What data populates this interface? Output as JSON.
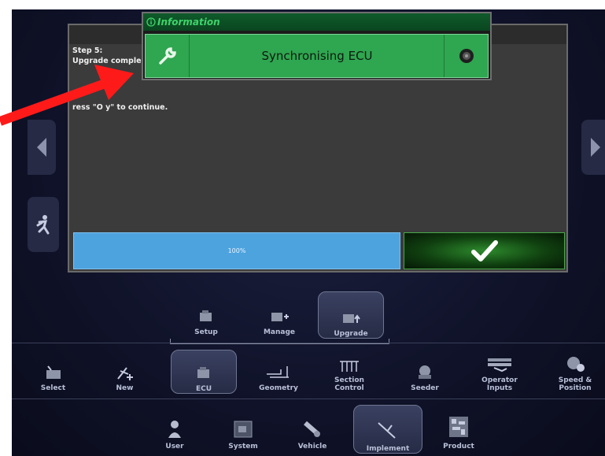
{
  "dialog": {
    "step_title": "Step 5:",
    "step_subtitle": "Upgrade comple",
    "instruction": "ress \"O  y\" to continue.",
    "progress": 1.0,
    "progress_label": "100%",
    "ok_icon": "checkmark-icon"
  },
  "info_popup": {
    "header": "Information",
    "header_icon": "info-icon",
    "message": "Synchronising ECU",
    "left_icon": "wrench-icon",
    "right_icon": "speaker-icon"
  },
  "sub_menu": [
    {
      "label": "Setup",
      "icon": "ecu-setup-icon"
    },
    {
      "label": "Manage",
      "icon": "ecu-manage-icon"
    },
    {
      "label": "Upgrade",
      "icon": "ecu-upgrade-icon",
      "selected": true
    }
  ],
  "implement_menu": [
    {
      "label": "Select",
      "icon": "select-icon"
    },
    {
      "label": "New",
      "icon": "new-icon"
    },
    {
      "label": "ECU",
      "icon": "ecu-icon",
      "selected": true
    },
    {
      "label": "Geometry",
      "icon": "geometry-icon"
    },
    {
      "label": "Section Control",
      "line1": "Section",
      "line2": "Control",
      "icon": "section-control-icon"
    },
    {
      "label": "Seeder",
      "icon": "seeder-icon"
    },
    {
      "label": "Operator Inputs",
      "line1": "Operator",
      "line2": "Inputs",
      "icon": "operator-inputs-icon"
    },
    {
      "label": "Speed & Position",
      "line1": "Speed &",
      "line2": "Position",
      "icon": "speed-position-icon"
    }
  ],
  "main_menu": [
    {
      "label": "User",
      "icon": "user-icon"
    },
    {
      "label": "System",
      "icon": "system-icon"
    },
    {
      "label": "Vehicle",
      "icon": "vehicle-icon"
    },
    {
      "label": "Implement",
      "icon": "implement-icon",
      "selected": true
    },
    {
      "label": "Product",
      "icon": "product-icon"
    }
  ],
  "colors": {
    "background": "#10132a",
    "info_green": "#2fa650",
    "progress_blue": "#4da3de",
    "annotation_red": "#ff1a1a"
  }
}
